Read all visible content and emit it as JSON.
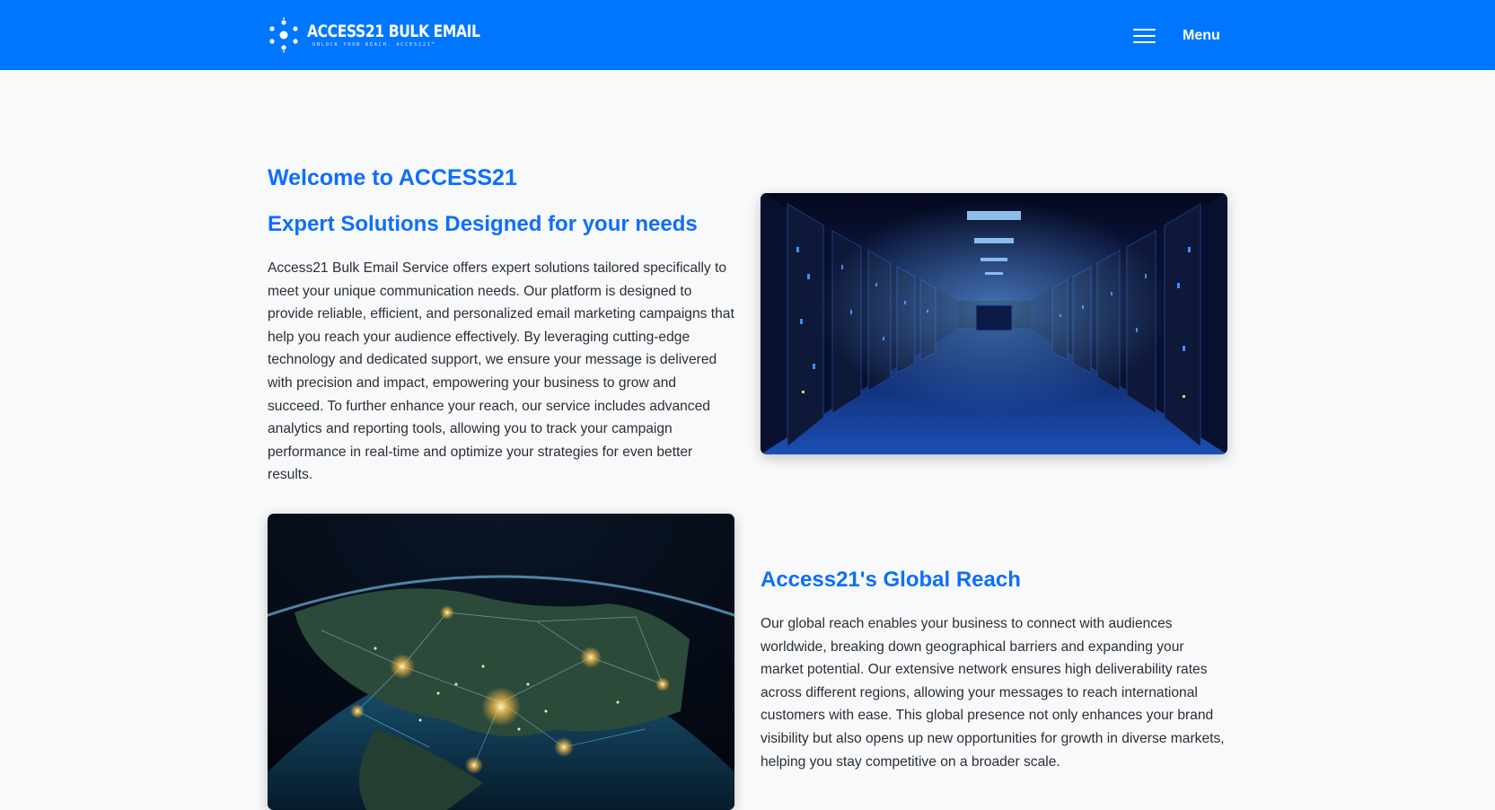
{
  "nav": {
    "brand_name": "ACCESS21 BULK EMAIL",
    "brand_tagline": "UNLOCK YOUR REACH. ACCESS21™",
    "menu_label": "Menu",
    "menu_icon": "hamburger-icon"
  },
  "sections": {
    "welcome_title": "Welcome to ACCESS21",
    "expert_title": "Expert Solutions Designed for your needs",
    "expert_text": "Access21 Bulk Email Service offers expert solutions tailored specifically to meet your unique communication needs. Our platform is designed to provide reliable, efficient, and personalized email marketing campaigns that help you reach your audience effectively. By leveraging cutting-edge technology and dedicated support, we ensure your message is delivered with precision and impact, empowering your business to grow and succeed. To further enhance your reach, our service includes advanced analytics and reporting tools, allowing you to track your campaign performance in real-time and optimize your strategies for even better results.",
    "reach_title": "Access21's Global Reach",
    "reach_text": "Our global reach enables your business to connect with audiences worldwide, breaking down geographical barriers and expanding your market potential. Our extensive network ensures high deliverability rates across different regions, allowing your messages to reach international customers with ease. This global presence not only enhances your brand visibility but also opens up new opportunities for growth in diverse markets, helping you stay competitive on a broader scale."
  },
  "colors": {
    "navbar": "#0076ff",
    "heading": "#0d6efd",
    "background": "#f8f9fa"
  }
}
